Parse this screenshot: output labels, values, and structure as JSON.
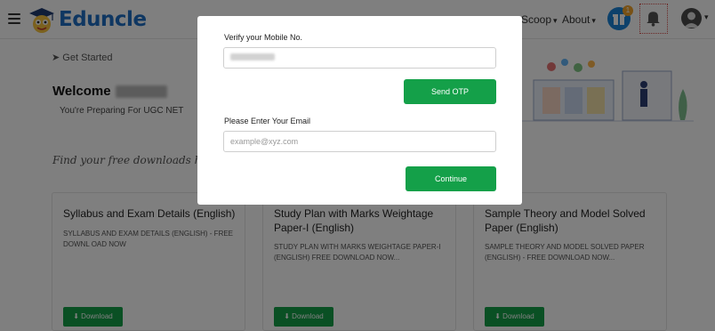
{
  "header": {
    "brand": "Eduncle",
    "nav": [
      {
        "label": "Scoop"
      },
      {
        "label": "About"
      }
    ],
    "notification_badge": "1",
    "colors": {
      "brand": "#1f6fc4",
      "accent_green": "#14a049",
      "badge": "#f0a32b"
    }
  },
  "main": {
    "get_started": "Get Started",
    "welcome": "Welcome",
    "preparing": "You're Preparing For UGC NET",
    "find_downloads": "Find your free downloads here",
    "cards": [
      {
        "title": "Syllabus and Exam Details (English)",
        "desc": "Syllabus and Exam Details (English) - FREE DOWNL OAD NOW",
        "button": "Download"
      },
      {
        "title": "Study Plan with Marks Weightage Paper-I (English)",
        "desc": "Study Plan with Marks Weightage Paper-I (English) FREE DOWNLOAD NOW...",
        "button": "Download"
      },
      {
        "title": "Sample Theory and Model Solved Paper (English)",
        "desc": "Sample Theory and Model Solved Paper (English) - FREE DOWNLOAD NOW...",
        "button": "Download"
      }
    ]
  },
  "modal": {
    "mobile_label": "Verify your Mobile No.",
    "mobile_value": "",
    "send_otp": "Send OTP",
    "email_label": "Please Enter Your Email",
    "email_placeholder": "example@xyz.com",
    "email_value": "",
    "continue": "Continue"
  },
  "icons": {
    "menu": "hamburger-icon",
    "gift": "gift-icon",
    "bell": "bell-icon",
    "send": "paper-plane-icon",
    "download": "download-icon"
  }
}
